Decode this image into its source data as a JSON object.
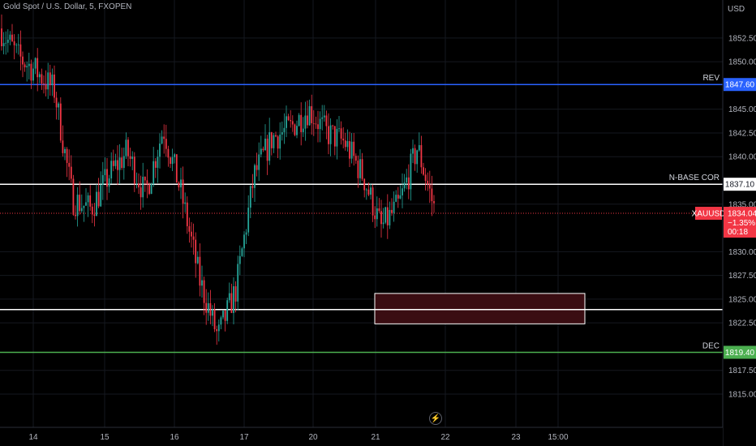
{
  "symbol_title": "Gold Spot / U.S. Dollar, 5, FXOPEN",
  "currency": "USD",
  "price_labels": {
    "rev": {
      "name": "REV",
      "value": "1847.60",
      "color": "#2962ff"
    },
    "nbase": {
      "name": "N-BASE COR",
      "value": "1837.10",
      "color": "#ffffff"
    },
    "dec": {
      "name": "DEC",
      "value": "1819.40",
      "color": "#4caf50"
    }
  },
  "last_price": {
    "symbol": "XAUUSD",
    "value": "1834.04",
    "change": "−1.35%",
    "countdown": "00:18",
    "color": "#f23645"
  },
  "icons": {
    "replay": "lightning-icon"
  },
  "chart_data": {
    "type": "candlestick",
    "ylim": [
      1811.5,
      1856.5
    ],
    "y_ticks": [
      1852.5,
      1850.0,
      1845.0,
      1842.5,
      1840.0,
      1835.0,
      1830.0,
      1827.5,
      1825.0,
      1822.5,
      1817.5,
      1815.0
    ],
    "x_ticks": [
      "14",
      "15",
      "16",
      "17",
      "20",
      "21",
      "22",
      "23",
      "15:00"
    ],
    "colors": {
      "up": "#26a69a",
      "down": "#f23645"
    },
    "horizontal_levels": [
      {
        "name": "REV",
        "price": 1847.6,
        "color": "#2962ff"
      },
      {
        "name": "N-BASE COR",
        "price": 1837.1,
        "color": "#ffffff"
      },
      {
        "price": 1823.9,
        "color": "#ffffff"
      },
      {
        "name": "DEC",
        "price": 1819.4,
        "color": "#4caf50"
      },
      {
        "price": 1834.04,
        "color": "#f23645",
        "style": "dotted"
      }
    ],
    "zone": {
      "from": "21",
      "to": "23",
      "top": 1825.6,
      "bottom": 1822.4,
      "fill": "#3a0d12",
      "border": "#ffffff"
    },
    "price_path": [
      [
        "14",
        1853.5
      ],
      [
        "14",
        1850.5
      ],
      [
        "15",
        1849.0
      ],
      [
        "15",
        1847.0
      ],
      [
        "15",
        1835.5
      ],
      [
        "16",
        1834.5
      ],
      [
        "16",
        1838.0
      ],
      [
        "16",
        1840.5
      ],
      [
        "17",
        1836.0
      ],
      [
        "17",
        1843.0
      ],
      [
        "17",
        1836.0
      ],
      [
        "17",
        1827.0
      ],
      [
        "17",
        1821.0
      ],
      [
        "20",
        1826.0
      ],
      [
        "20",
        1838.0
      ],
      [
        "20",
        1842.0
      ],
      [
        "20",
        1843.0
      ],
      [
        "21",
        1845.0
      ],
      [
        "21",
        1842.5
      ],
      [
        "21",
        1841.5
      ],
      [
        "21",
        1838.0
      ],
      [
        "21",
        1832.5
      ],
      [
        "22",
        1835.0
      ],
      [
        "22",
        1841.0
      ],
      [
        "22",
        1834.0
      ]
    ]
  }
}
